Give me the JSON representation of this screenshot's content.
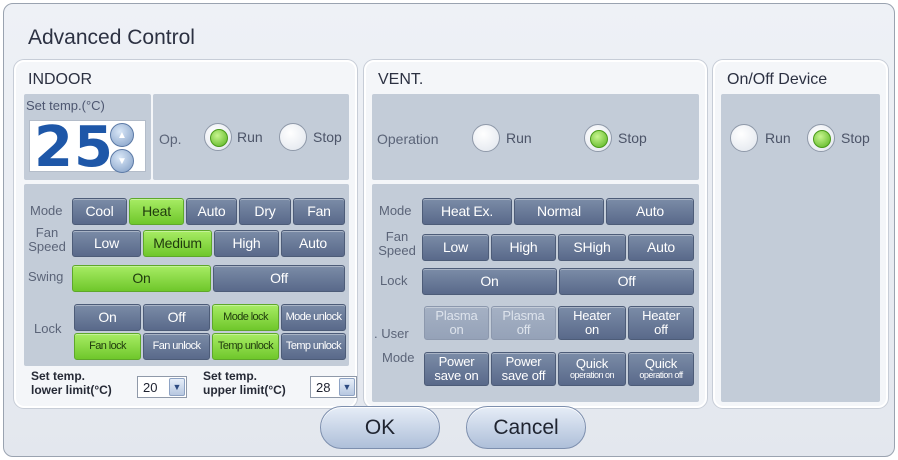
{
  "dialog": {
    "title": "Advanced Control"
  },
  "indoor": {
    "title": "INDOOR",
    "set_temp_label": "Set temp.(°C)",
    "set_temp_value": "25",
    "op_label": "Op.",
    "run_label": "Run",
    "stop_label": "Stop",
    "operation_state": "Run",
    "mode_label": "Mode",
    "mode_options": [
      "Cool",
      "Heat",
      "Auto",
      "Dry",
      "Fan"
    ],
    "mode_selected": "Heat",
    "fan_speed_label": "Fan Speed",
    "fan_speed_options": [
      "Low",
      "Medium",
      "High",
      "Auto"
    ],
    "fan_speed_selected": "Medium",
    "swing_label": "Swing",
    "swing_on": "On",
    "swing_off": "Off",
    "swing_selected": "On",
    "lock_label": "Lock",
    "lock_buttons": [
      "On",
      "Off",
      "Mode lock",
      "Mode unlock",
      "Fan lock",
      "Fan unlock",
      "Temp unlock",
      "Temp unlock"
    ],
    "lower_limit_label_1": "Set temp.",
    "lower_limit_label_2": "lower limit(°C)",
    "lower_limit_value": "20",
    "upper_limit_label_1": "Set temp.",
    "upper_limit_label_2": "upper limit(°C)",
    "upper_limit_value": "28"
  },
  "vent": {
    "title": "VENT.",
    "operation_label": "Operation",
    "run_label": "Run",
    "stop_label": "Stop",
    "operation_state": "Stop",
    "mode_label": "Mode",
    "mode_options": [
      "Heat Ex.",
      "Normal",
      "Auto"
    ],
    "fan_speed_label": "Fan Speed",
    "fan_speed_options": [
      "Low",
      "High",
      "SHigh",
      "Auto"
    ],
    "lock_label": "Lock",
    "lock_on": "On",
    "lock_off": "Off",
    "user_mode_label_1": ". User",
    "user_mode_label_2": "Mode",
    "user_mode_row1": [
      {
        "line1": "Plasma",
        "line2": "on",
        "enabled": false
      },
      {
        "line1": "Plasma",
        "line2": "off",
        "enabled": false
      },
      {
        "line1": "Heater",
        "line2": "on",
        "enabled": true
      },
      {
        "line1": "Heater",
        "line2": "off",
        "enabled": true
      }
    ],
    "user_mode_row2": [
      {
        "line1": "Power",
        "line2": "save on"
      },
      {
        "line1": "Power",
        "line2": "save off"
      },
      {
        "line1": "Quick",
        "line2": "operation on"
      },
      {
        "line1": "Quick",
        "line2": "operation off"
      }
    ]
  },
  "onoff": {
    "title": "On/Off Device",
    "run_label": "Run",
    "stop_label": "Stop",
    "operation_state": "Stop"
  },
  "footer": {
    "ok_label": "OK",
    "cancel_label": "Cancel"
  },
  "colors": {
    "selected": "#7ed33a",
    "button": "#64759a",
    "panel": "#c3ccd8",
    "digits": "#1e57a8"
  }
}
